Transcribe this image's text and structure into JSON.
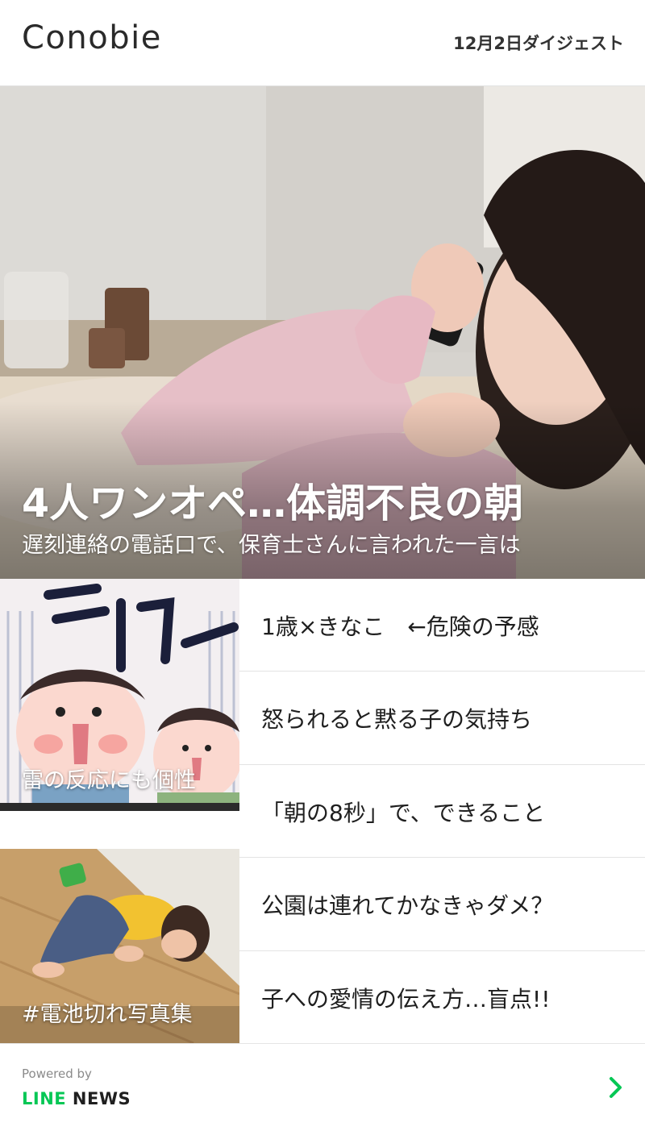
{
  "header": {
    "logo": "Conobie",
    "digest_label": "12月2日ダイジェスト"
  },
  "hero": {
    "title": "4人ワンオペ…体調不良の朝",
    "subtitle": "遅刻連絡の電話口で、保育士さんに言われた一言は"
  },
  "thumbnails": [
    {
      "caption": "雷の反応にも個性"
    },
    {
      "caption": "#電池切れ写真集"
    }
  ],
  "articles": [
    {
      "title": "1歳×きなこ　←危険の予感"
    },
    {
      "title": "怒られると黙る子の気持ち"
    },
    {
      "title": "「朝の8秒」で、できること"
    },
    {
      "title": "公園は連れてかなきゃダメ？"
    },
    {
      "title": "子への愛情の伝え方…盲点!!"
    }
  ],
  "footer": {
    "powered_by": "Powered by",
    "brand_line": "LINE",
    "brand_news": " NEWS"
  },
  "colors": {
    "accent": "#06c755",
    "divider": "#e3e3e3"
  },
  "icons": {
    "more": "chevron-right-icon"
  }
}
